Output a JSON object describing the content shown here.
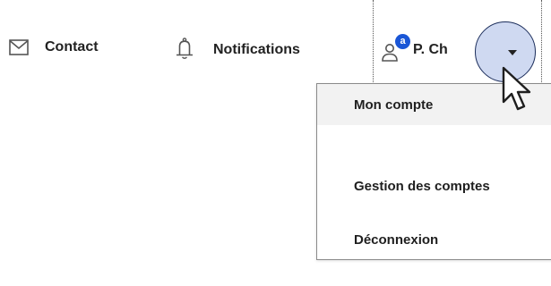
{
  "header": {
    "contact": {
      "label": "Contact",
      "icon": "mail-icon"
    },
    "notifications": {
      "label": "Notifications",
      "icon": "bell-icon"
    },
    "user": {
      "label": "P. Ch",
      "icon": "user-icon",
      "badge": "a"
    },
    "dropdown_toggle": {
      "icon": "caret-down-icon"
    }
  },
  "menu": {
    "items": [
      {
        "label": "Mon compte"
      },
      {
        "label": "Gestion des comptes"
      },
      {
        "label": "Déconnexion"
      }
    ]
  },
  "colors": {
    "accent": "#1a56d6",
    "toggle_highlight": "#cfd9f1",
    "toggle_border": "#1b2d5b",
    "active_item_bg": "#f2f2f2"
  }
}
